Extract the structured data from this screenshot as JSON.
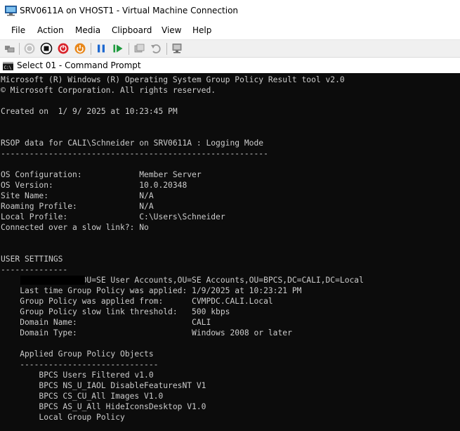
{
  "window": {
    "title": "SRV0611A on VHOST1 - Virtual Machine Connection",
    "app_icon": "vm-monitor-icon"
  },
  "menu": [
    "File",
    "Action",
    "Media",
    "Clipboard",
    "View",
    "Help"
  ],
  "toolbar": {
    "icons": [
      "ctrl-alt-del-icon",
      "start-icon",
      "turn-off-icon",
      "shut-down-icon",
      "save-state-icon",
      "pause-icon",
      "resume-icon",
      "checkpoint-icon",
      "revert-icon",
      "enhanced-session-icon"
    ],
    "colors": {
      "red": "#d9242b",
      "orange": "#e8871a",
      "blue": "#1c68d0",
      "green": "#1e9a3e"
    }
  },
  "cmd": {
    "title": "Select 01 - Command Prompt"
  },
  "console": {
    "background": "#0c0c0c",
    "foreground": "#cccccc",
    "lines": [
      "Microsoft (R) Windows (R) Operating System Group Policy Result tool v2.0",
      "© Microsoft Corporation. All rights reserved.",
      "",
      "Created on  1/ 9/ 2025 at 10:23:45 PM",
      "",
      "",
      "RSOP data for CALI\\Schneider on SRV0611A : Logging Mode",
      "--------------------------------------------------------",
      "",
      "OS Configuration:            Member Server",
      "OS Version:                  10.0.20348",
      "Site Name:                   N/A",
      "Roaming Profile:             N/A",
      "Local Profile:               C:\\Users\\Schneider",
      "Connected over a slow link?: No",
      "",
      "",
      "USER SETTINGS",
      "--------------",
      "                 OU=SE User Accounts,OU=SE Accounts,OU=BPCS,DC=CALI,DC=Local",
      "    Last time Group Policy was applied: 1/9/2025 at 10:23:21 PM",
      "    Group Policy was applied from:      CVMPDC.CALI.Local",
      "    Group Policy slow link threshold:   500 kbps",
      "    Domain Name:                        CALI",
      "    Domain Type:                        Windows 2008 or later",
      "",
      "    Applied Group Policy Objects",
      "    -----------------------------",
      "        BPCS Users Filtered v1.0",
      "        BPCS NS_U_IAOL DisableFeaturesNT V1",
      "        BPCS CS_CU_All Images V1.0",
      "        BPCS AS_U_All HideIconsDesktop V1.0",
      "        Local Group Policy"
    ]
  }
}
